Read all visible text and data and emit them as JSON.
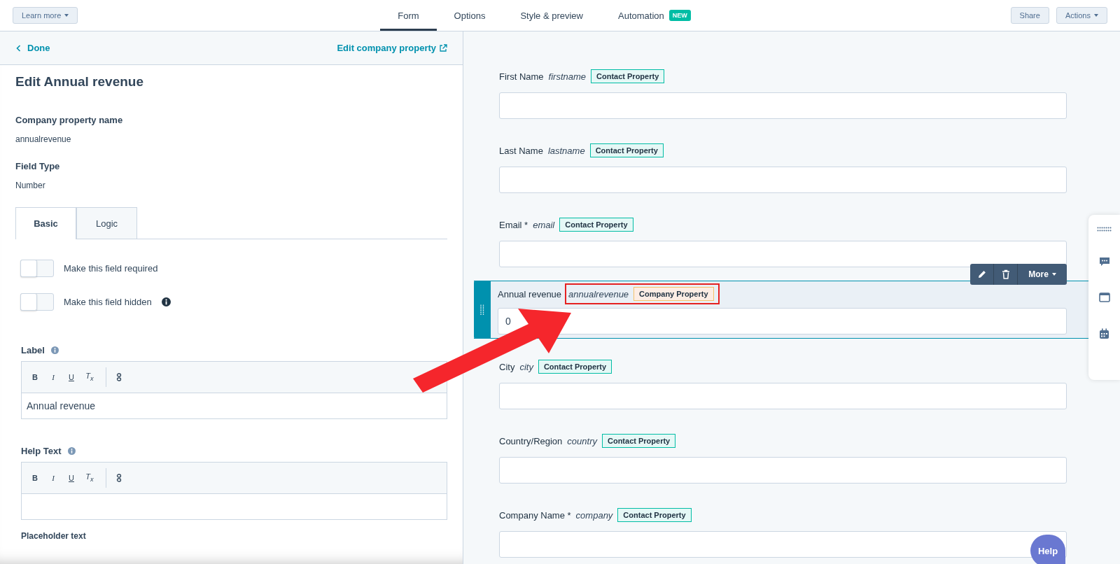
{
  "top_bar": {
    "learn_more": "Learn more",
    "tabs": [
      {
        "label": "Form",
        "selected": true
      },
      {
        "label": "Options",
        "selected": false
      },
      {
        "label": "Style & preview",
        "selected": false
      },
      {
        "label": "Automation",
        "selected": false,
        "badge": "NEW"
      }
    ],
    "share": "Share",
    "actions": "Actions"
  },
  "left_panel": {
    "back": "Done",
    "edit_link": "Edit company property",
    "title": "Edit Annual revenue",
    "properties": [
      {
        "label": "Company property name",
        "value": "annualrevenue"
      },
      {
        "label": "Field Type",
        "value": "Number"
      }
    ],
    "tabs": [
      {
        "label": "Basic",
        "selected": true
      },
      {
        "label": "Logic",
        "selected": false
      }
    ],
    "toggles": [
      {
        "label": "Make this field required",
        "on": false,
        "info": false
      },
      {
        "label": "Make this field hidden",
        "on": false,
        "info": true
      }
    ],
    "editors": [
      {
        "label": "Label",
        "toolbar": [
          "B",
          "I",
          "U",
          "T$_{x}$"
        ],
        "value": "Annual revenue"
      },
      {
        "label": "Help Text",
        "toolbar": [
          "B",
          "I",
          "U",
          "T$_{x}$"
        ]
      }
    ],
    "cut_label": "Placeholder text"
  },
  "form": {
    "fields": [
      {
        "label": "First Name",
        "name": "firstname",
        "tag": "Contact Property",
        "kind": "contact",
        "selected": false
      },
      {
        "label": "Last Name",
        "name": "lastname",
        "tag": "Contact Property",
        "kind": "contact",
        "selected": false
      },
      {
        "label": "Email *",
        "name": "email",
        "tag": "Contact Property",
        "kind": "contact",
        "selected": false
      },
      {
        "label": "Annual revenue",
        "name": "annualrevenue",
        "tag": "Company Property",
        "kind": "company",
        "selected": true,
        "value": "0"
      },
      {
        "label": "City",
        "name": "city",
        "tag": "Contact Property",
        "kind": "contact",
        "selected": false
      },
      {
        "label": "Country/Region",
        "name": "country",
        "tag": "Contact Property",
        "kind": "contact",
        "selected": false
      },
      {
        "label": "Company Name *",
        "name": "company",
        "tag": "Contact Property",
        "kind": "contact",
        "selected": false
      }
    ],
    "field_toolbar_more": "More"
  },
  "help_button": "Help"
}
